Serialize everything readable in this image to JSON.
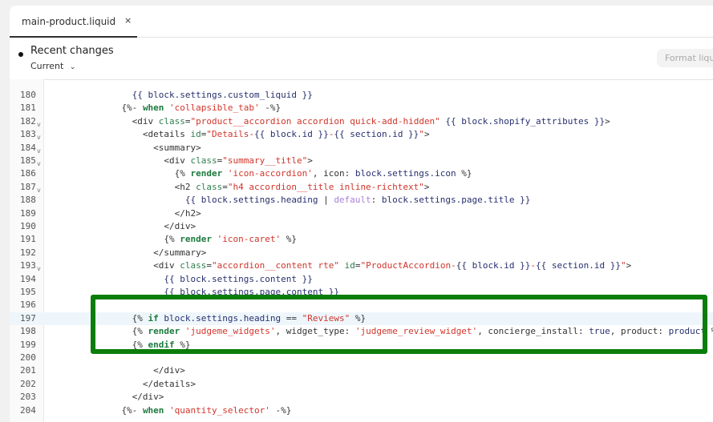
{
  "tab": {
    "label": "main-product.liquid",
    "close": "×"
  },
  "header": {
    "title": "Recent changes",
    "version": "Current",
    "format_button": "Format liquid"
  },
  "highlight_color": "#0b7d0b",
  "lines": [
    {
      "n": "180",
      "i": 14,
      "tk": [
        [
          "v",
          "{{ block.settings.custom_liquid }}"
        ]
      ]
    },
    {
      "n": "181",
      "i": 12,
      "tk": [
        [
          "p",
          "{%- "
        ],
        [
          "k",
          "when"
        ],
        [
          "s",
          " 'collapsible_tab'"
        ],
        [
          "p",
          " -%}"
        ]
      ]
    },
    {
      "n": "182",
      "i": 14,
      "fold": true,
      "tk": [
        [
          "t",
          "<div "
        ],
        [
          "a",
          "class"
        ],
        [
          "p",
          "="
        ],
        [
          "s",
          "\"product__accordion accordion quick-add-hidden\""
        ],
        [
          "v",
          " {{ block.shopify_attributes }}"
        ],
        [
          "t",
          ">"
        ]
      ]
    },
    {
      "n": "183",
      "i": 16,
      "fold": true,
      "tk": [
        [
          "t",
          "<details "
        ],
        [
          "a",
          "id"
        ],
        [
          "p",
          "="
        ],
        [
          "s",
          "\"Details-"
        ],
        [
          "v",
          "{{ block.id }}"
        ],
        [
          "s",
          "-"
        ],
        [
          "v",
          "{{ section.id }}"
        ],
        [
          "s",
          "\""
        ],
        [
          "t",
          ">"
        ]
      ]
    },
    {
      "n": "184",
      "i": 18,
      "fold": true,
      "tk": [
        [
          "t",
          "<summary>"
        ]
      ]
    },
    {
      "n": "185",
      "i": 20,
      "fold": true,
      "tk": [
        [
          "t",
          "<div "
        ],
        [
          "a",
          "class"
        ],
        [
          "p",
          "="
        ],
        [
          "s",
          "\"summary__title\""
        ],
        [
          "t",
          ">"
        ]
      ]
    },
    {
      "n": "186",
      "i": 22,
      "tk": [
        [
          "p",
          "{% "
        ],
        [
          "k",
          "render"
        ],
        [
          "s",
          " 'icon-accordion'"
        ],
        [
          "p",
          ", icon: "
        ],
        [
          "v",
          "block.settings.icon"
        ],
        [
          "p",
          " %}"
        ]
      ]
    },
    {
      "n": "187",
      "i": 22,
      "fold": true,
      "tk": [
        [
          "t",
          "<h2 "
        ],
        [
          "a",
          "class"
        ],
        [
          "p",
          "="
        ],
        [
          "s",
          "\"h4 accordion__title inline-richtext\""
        ],
        [
          "t",
          ">"
        ]
      ]
    },
    {
      "n": "188",
      "i": 24,
      "tk": [
        [
          "v",
          "{{ block.settings.heading "
        ],
        [
          "p",
          "| "
        ],
        [
          "f",
          "default"
        ],
        [
          "p",
          ": "
        ],
        [
          "v",
          "block.settings.page.title }}"
        ]
      ]
    },
    {
      "n": "189",
      "i": 22,
      "tk": [
        [
          "t",
          "</h2>"
        ]
      ]
    },
    {
      "n": "190",
      "i": 20,
      "tk": [
        [
          "t",
          "</div>"
        ]
      ]
    },
    {
      "n": "191",
      "i": 20,
      "tk": [
        [
          "p",
          "{% "
        ],
        [
          "k",
          "render"
        ],
        [
          "s",
          " 'icon-caret'"
        ],
        [
          "p",
          " %}"
        ]
      ]
    },
    {
      "n": "192",
      "i": 18,
      "tk": [
        [
          "t",
          "</summary>"
        ]
      ]
    },
    {
      "n": "193",
      "i": 18,
      "fold": true,
      "tk": [
        [
          "t",
          "<div "
        ],
        [
          "a",
          "class"
        ],
        [
          "p",
          "="
        ],
        [
          "s",
          "\"accordion__content rte\""
        ],
        [
          "a",
          " id"
        ],
        [
          "p",
          "="
        ],
        [
          "s",
          "\"ProductAccordion-"
        ],
        [
          "v",
          "{{ block.id }}"
        ],
        [
          "s",
          "-"
        ],
        [
          "v",
          "{{ section.id }}"
        ],
        [
          "s",
          "\""
        ],
        [
          "t",
          ">"
        ]
      ]
    },
    {
      "n": "194",
      "i": 20,
      "tk": [
        [
          "v",
          "{{ block.settings.content }}"
        ]
      ]
    },
    {
      "n": "195",
      "i": 20,
      "tk": [
        [
          "v",
          "{{ block.settings.page.content }}"
        ]
      ]
    },
    {
      "n": "196",
      "i": 0,
      "tk": []
    },
    {
      "n": "197",
      "i": 14,
      "hl": true,
      "tk": [
        [
          "p",
          "{% "
        ],
        [
          "k",
          "if"
        ],
        [
          "v",
          " block.settings.heading "
        ],
        [
          "p",
          "== "
        ],
        [
          "s",
          "\"Reviews\""
        ],
        [
          "p",
          " %}"
        ]
      ]
    },
    {
      "n": "198",
      "i": 14,
      "tk": [
        [
          "p",
          "{% "
        ],
        [
          "k",
          "render"
        ],
        [
          "s",
          " 'judgeme_widgets'"
        ],
        [
          "p",
          ", widget_type: "
        ],
        [
          "s",
          "'judgeme_review_widget'"
        ],
        [
          "p",
          ", concierge_install: "
        ],
        [
          "v",
          "true"
        ],
        [
          "p",
          ", product: "
        ],
        [
          "v",
          "product"
        ],
        [
          "p",
          " %}"
        ]
      ]
    },
    {
      "n": "199",
      "i": 14,
      "tk": [
        [
          "p",
          "{% "
        ],
        [
          "k",
          "endif"
        ],
        [
          "p",
          " %}"
        ]
      ]
    },
    {
      "n": "200",
      "i": 0,
      "tk": []
    },
    {
      "n": "201",
      "i": 18,
      "tk": [
        [
          "t",
          "</div>"
        ]
      ]
    },
    {
      "n": "202",
      "i": 16,
      "tk": [
        [
          "t",
          "</details>"
        ]
      ]
    },
    {
      "n": "203",
      "i": 14,
      "tk": [
        [
          "t",
          "</div>"
        ]
      ]
    },
    {
      "n": "204",
      "i": 12,
      "tk": [
        [
          "p",
          "{%- "
        ],
        [
          "k",
          "when"
        ],
        [
          "s",
          " 'quantity_selector'"
        ],
        [
          "p",
          " -%}"
        ]
      ]
    }
  ]
}
